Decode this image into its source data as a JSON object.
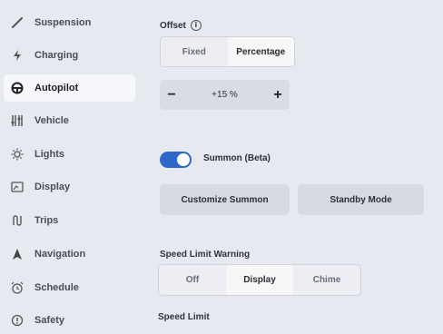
{
  "sidebar": {
    "items": [
      {
        "label": "Suspension",
        "icon": "suspension-icon"
      },
      {
        "label": "Charging",
        "icon": "lightning-icon"
      },
      {
        "label": "Autopilot",
        "icon": "steering-wheel-icon",
        "active": true
      },
      {
        "label": "Vehicle",
        "icon": "sliders-icon"
      },
      {
        "label": "Lights",
        "icon": "sun-icon"
      },
      {
        "label": "Display",
        "icon": "display-icon"
      },
      {
        "label": "Trips",
        "icon": "trips-icon"
      },
      {
        "label": "Navigation",
        "icon": "navigation-arrow-icon"
      },
      {
        "label": "Schedule",
        "icon": "alarm-clock-icon"
      },
      {
        "label": "Safety",
        "icon": "safety-icon"
      }
    ]
  },
  "offset": {
    "title": "Offset",
    "info_icon": "i",
    "options": [
      "Fixed",
      "Percentage"
    ],
    "selected": "Percentage",
    "minus": "−",
    "plus": "+",
    "value": "+15 %"
  },
  "summon": {
    "toggle_on": true,
    "label": "Summon (Beta)",
    "customize_button": "Customize Summon",
    "standby_button": "Standby Mode"
  },
  "speed_limit_warning": {
    "title": "Speed Limit Warning",
    "options": [
      "Off",
      "Display",
      "Chime"
    ],
    "selected": "Display"
  },
  "speed_limit": {
    "title": "Speed Limit"
  },
  "colors": {
    "toggle_on": "#2f66c9",
    "background": "#e7e9f0",
    "active_item": "#f6f7fa"
  }
}
